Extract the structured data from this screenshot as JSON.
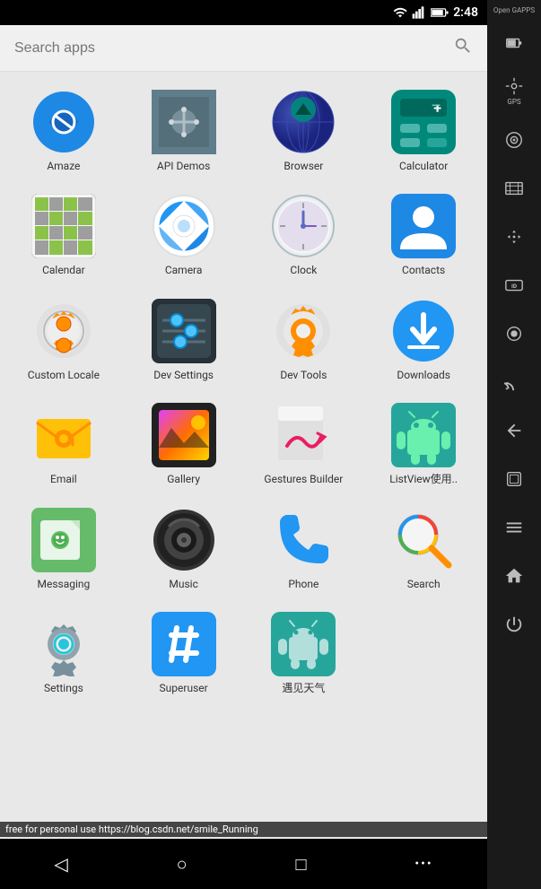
{
  "statusBar": {
    "time": "2:48",
    "batteryIcon": "battery",
    "signalIcon": "signal"
  },
  "searchBar": {
    "placeholder": "Search apps"
  },
  "sidebar": {
    "topLabel": "Open\nGAPPS",
    "items": [
      {
        "name": "battery-sidebar",
        "icon": "battery"
      },
      {
        "name": "gps",
        "icon": "gps"
      },
      {
        "name": "camera-toggle",
        "icon": "camera"
      },
      {
        "name": "video",
        "icon": "video"
      },
      {
        "name": "move",
        "icon": "move"
      },
      {
        "name": "id",
        "icon": "id"
      },
      {
        "name": "record",
        "icon": "record"
      },
      {
        "name": "cast",
        "icon": "cast"
      },
      {
        "name": "back",
        "icon": "back"
      },
      {
        "name": "recents",
        "icon": "recents"
      },
      {
        "name": "menu",
        "icon": "menu"
      },
      {
        "name": "home",
        "icon": "home"
      },
      {
        "name": "power",
        "icon": "power"
      }
    ]
  },
  "apps": [
    [
      {
        "label": "Amaze",
        "id": "amaze"
      },
      {
        "label": "API Demos",
        "id": "api-demos"
      },
      {
        "label": "Browser",
        "id": "browser"
      },
      {
        "label": "Calculator",
        "id": "calculator"
      }
    ],
    [
      {
        "label": "Calendar",
        "id": "calendar"
      },
      {
        "label": "Camera",
        "id": "camera"
      },
      {
        "label": "Clock",
        "id": "clock"
      },
      {
        "label": "Contacts",
        "id": "contacts"
      }
    ],
    [
      {
        "label": "Custom Locale",
        "id": "custom-locale"
      },
      {
        "label": "Dev Settings",
        "id": "dev-settings"
      },
      {
        "label": "Dev Tools",
        "id": "dev-tools"
      },
      {
        "label": "Downloads",
        "id": "downloads"
      }
    ],
    [
      {
        "label": "Email",
        "id": "email"
      },
      {
        "label": "Gallery",
        "id": "gallery"
      },
      {
        "label": "Gestures Builder",
        "id": "gestures"
      },
      {
        "label": "ListView使用..",
        "id": "listview"
      }
    ],
    [
      {
        "label": "Messaging",
        "id": "messaging"
      },
      {
        "label": "Music",
        "id": "music"
      },
      {
        "label": "Phone",
        "id": "phone"
      },
      {
        "label": "Search",
        "id": "search"
      }
    ],
    [
      {
        "label": "Settings",
        "id": "settings"
      },
      {
        "label": "Superuser",
        "id": "superuser"
      },
      {
        "label": "遇见天气",
        "id": "weather"
      },
      {
        "label": "",
        "id": "empty"
      }
    ]
  ],
  "bottomNav": {
    "backLabel": "◁",
    "homeLabel": "○",
    "recentsLabel": "□"
  },
  "watermark": "free for personal use  https://blog.csdn.net/smile_Running"
}
